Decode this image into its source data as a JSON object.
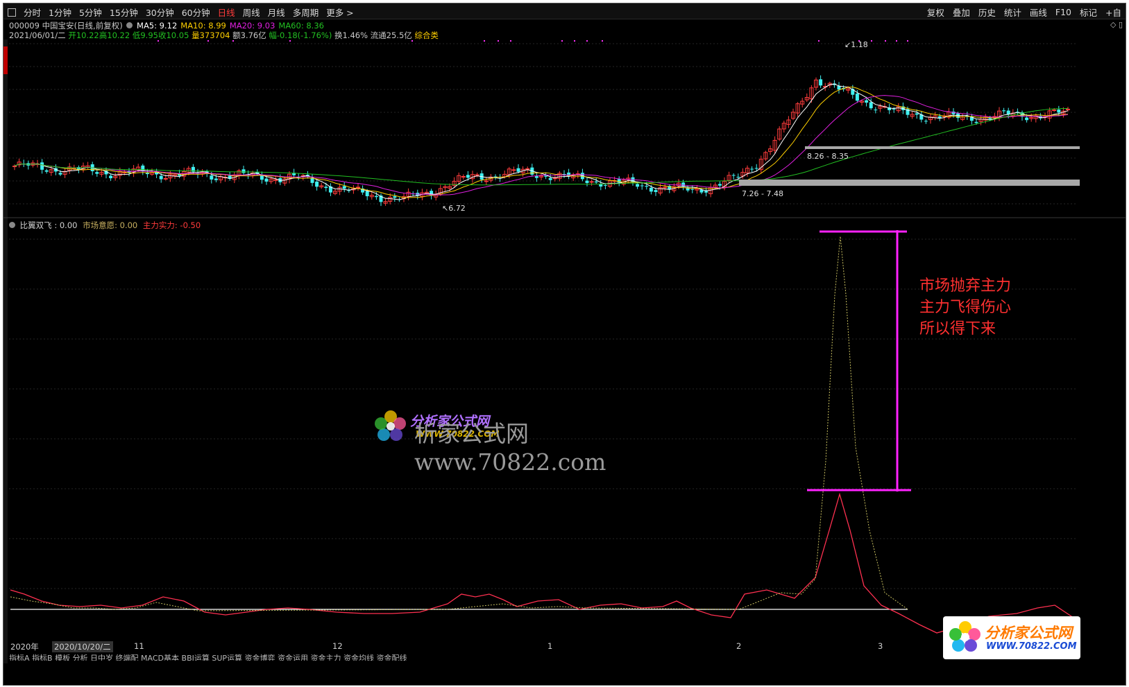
{
  "toolbar": {
    "periods": [
      "分时",
      "1分钟",
      "5分钟",
      "15分钟",
      "30分钟",
      "60分钟",
      "日线",
      "周线",
      "月线",
      "多周期",
      "更多 >"
    ],
    "active_period": "日线",
    "right_items": [
      "复权",
      "叠加",
      "历史",
      "统计",
      "画线",
      "F10",
      "标记",
      "+自"
    ]
  },
  "stock": {
    "code": "000009",
    "name": "中国宝安",
    "mode": "(日线,前复权)",
    "ma": [
      {
        "label": "MA5: 9.12",
        "color": "#ffffff"
      },
      {
        "label": "MA10: 8.99",
        "color": "#ffd000"
      },
      {
        "label": "MA20: 9.03",
        "color": "#e020e0"
      },
      {
        "label": "MA60: 8.36",
        "color": "#22c022"
      }
    ],
    "quote": {
      "date": "2021/06/01/二",
      "open": "开10.22",
      "high": "高10.22",
      "low": "低9.95",
      "close": "收10.05",
      "volume": "量373704",
      "amount": "额3.76亿",
      "change": "幅-0.18(-1.76%)",
      "turnover": "换1.46%",
      "float_cap": "流通25.5亿",
      "category": "综合类"
    },
    "price_labels": {
      "high": "1.18",
      "low": "6.72",
      "zone1": "8.26 - 8.35",
      "zone2": "7.26 - 7.48"
    }
  },
  "indicator": {
    "name": "比翼双飞",
    "value": ": 0.00",
    "market_label": "市场意愿: 0.00",
    "main_label": "主力实力: -0.50"
  },
  "annotation": {
    "lines": [
      "市场抛弃主力",
      "主力飞得伤心",
      "所以得下来"
    ],
    "color": "#ff3030",
    "bracket_color": "#ff22ff"
  },
  "watermark": {
    "brand": "分析家公式网",
    "url": "WWW.70822.COM",
    "big_text": "析家公式网www.70822.com"
  },
  "corner_brand": {
    "name": "分析家公式网",
    "url": "WWW.70822.COM"
  },
  "xaxis": {
    "labels": [
      "2020年",
      "11",
      "12",
      "1",
      "2",
      "3"
    ],
    "cursor_date": "2020/10/20/二"
  },
  "bottom_tabs": "指标A 指标B 模板 分析 日中岁 终端配 MACD基本 BBI运算 SUP运算 资金博弈 资金运用 资金主力 资金均线 资金配线"
}
